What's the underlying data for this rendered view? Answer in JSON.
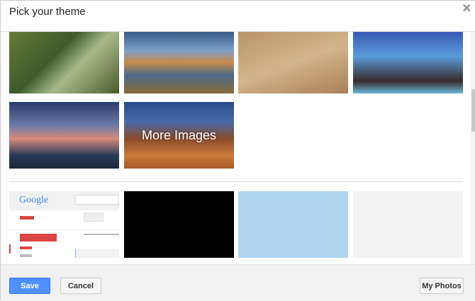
{
  "dialog": {
    "title": "Pick your theme",
    "close": "✕"
  },
  "themes": {
    "more_images": "More Images",
    "gmail_preview_logo": "Google"
  },
  "footer": {
    "save": "Save",
    "cancel": "Cancel",
    "my_photos": "My Photos"
  }
}
